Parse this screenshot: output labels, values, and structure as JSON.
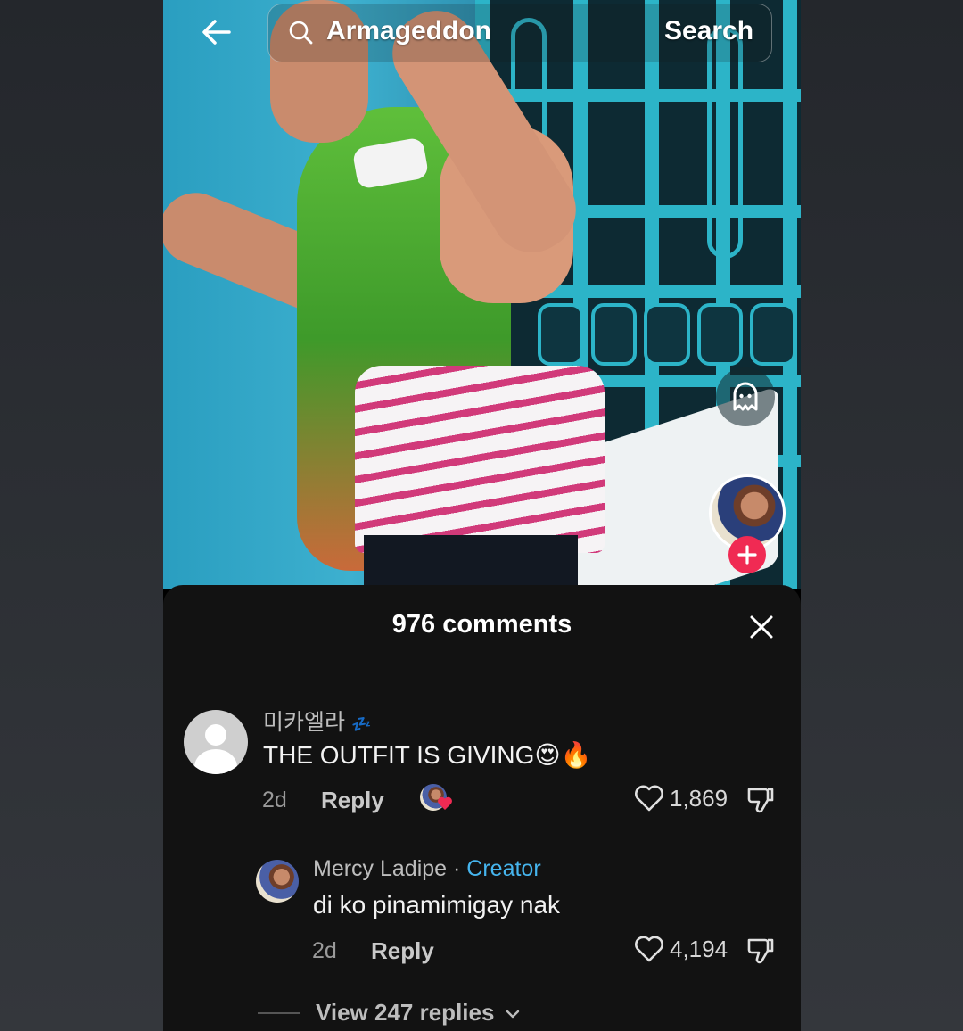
{
  "search": {
    "query": "Armageddon",
    "button_label": "Search"
  },
  "icons": {
    "back": "back-arrow-icon",
    "search": "search-icon",
    "ghost": "ghost-icon",
    "follow": "plus-icon",
    "close": "close-icon",
    "like": "heart-icon",
    "dislike": "thumbs-down-icon",
    "chevron": "chevron-down-icon"
  },
  "colors": {
    "follow_button": "#f02a53",
    "creator_tag": "#46b5ee",
    "sheet_background": "#121212"
  },
  "comments_sheet": {
    "title": "976 comments",
    "comments": [
      {
        "username": "미카엘라",
        "username_suffix": "💤",
        "text": "THE OUTFIT IS GIVING😍🔥",
        "age": "2d",
        "reply_label": "Reply",
        "likes": "1,869",
        "creator_liked": true
      }
    ],
    "replies": [
      {
        "username": "Mercy Ladipe",
        "separator": " · ",
        "tag": "Creator",
        "text": "di ko pinamimigay nak",
        "age": "2d",
        "reply_label": "Reply",
        "likes": "4,194"
      }
    ],
    "view_replies_label": "View 247 replies"
  }
}
